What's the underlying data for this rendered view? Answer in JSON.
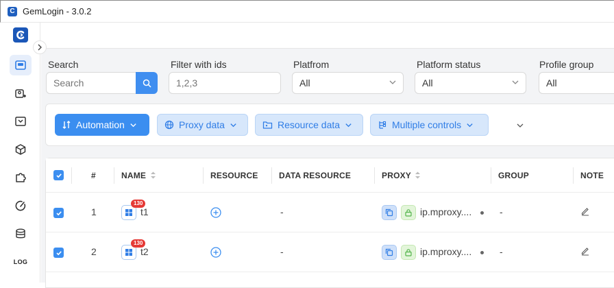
{
  "window": {
    "title": "GemLogin - 3.0.2"
  },
  "sidebar": {
    "items": [
      {
        "icon": "profile-icon"
      },
      {
        "icon": "add-profile-icon"
      },
      {
        "icon": "inbox-icon"
      },
      {
        "icon": "cube-icon"
      },
      {
        "icon": "puzzle-icon"
      },
      {
        "icon": "gauge-icon"
      },
      {
        "icon": "database-icon"
      },
      {
        "label": "LOG"
      }
    ]
  },
  "filters": {
    "search": {
      "label": "Search",
      "placeholder": "Search"
    },
    "ids": {
      "label": "Filter with ids",
      "placeholder": "1,2,3"
    },
    "platform": {
      "label": "Platfrom",
      "value": "All"
    },
    "platform_status": {
      "label": "Platform status",
      "value": "All"
    },
    "profile_group": {
      "label": "Profile group",
      "value": "All"
    }
  },
  "toolbar": {
    "automation": "Automation",
    "proxy_data": "Proxy data",
    "resource_data": "Resource data",
    "multiple_controls": "Multiple controls"
  },
  "table": {
    "headers": {
      "index": "#",
      "name": "NAME",
      "resource": "RESOURCE",
      "data_resource": "DATA RESOURCE",
      "proxy": "PROXY",
      "group": "GROUP",
      "note": "NOTE"
    },
    "rows": [
      {
        "index": "1",
        "badge": "130",
        "name": "t1",
        "data_resource": "-",
        "proxy": "ip.mproxy....",
        "group": "-"
      },
      {
        "index": "2",
        "badge": "130",
        "name": "t2",
        "data_resource": "-",
        "proxy": "ip.mproxy....",
        "group": "-"
      }
    ]
  },
  "colors": {
    "accent": "#3b8ef0",
    "brand": "#1b57b8",
    "badge": "#e53935"
  }
}
